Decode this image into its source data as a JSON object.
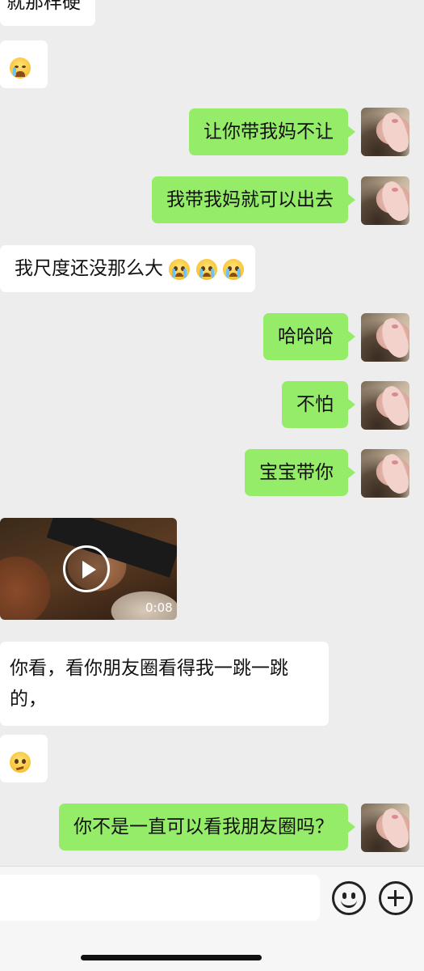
{
  "messages": {
    "m0": "就那样硬",
    "m2": "让你带我妈不让",
    "m3": "我带我妈就可以出去",
    "m4": "我尺度还没那么大",
    "m5": "哈哈哈",
    "m6": "不怕",
    "m7": "宝宝带你",
    "m9_line1": "你看，看你朋友圈看得我一跳一跳",
    "m9_line2": "的，",
    "m11": "你不是一直可以看我朋友圈吗？"
  },
  "video": {
    "duration": "0:08"
  },
  "icons": {
    "emoji_cry_laugh": "crying-laughing-emoji",
    "emoji_cry": "crying-face-emoji",
    "emoji_confused": "confused-face-emoji",
    "voice": "smile-icon",
    "add": "plus-icon",
    "play": "play-icon"
  },
  "colors": {
    "outgoing": "#95ec69",
    "incoming": "#ffffff",
    "background": "#ededed"
  }
}
